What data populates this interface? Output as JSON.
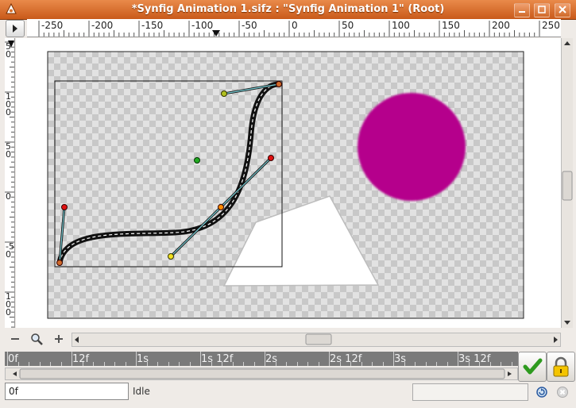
{
  "window": {
    "title": "*Synfig Animation 1.sifz : \"Synfig Animation 1\" (Root)"
  },
  "ruler_h": {
    "labels": [
      "-250",
      "-200",
      "-150",
      "-100",
      "-50",
      "0",
      "50",
      "100",
      "150",
      "200",
      "250"
    ]
  },
  "ruler_v": {
    "labels": [
      "5\n0",
      "1\n0\n0",
      "5\n0",
      "0",
      "-5\n0",
      "1\n0\n0"
    ]
  },
  "timebar": {
    "labels": [
      "0f",
      "12f",
      "1s",
      "1s 12f",
      "2s",
      "2s 12f",
      "3s",
      "3s 12f"
    ]
  },
  "time_field": {
    "value": "0f"
  },
  "status": {
    "text": "Idle"
  },
  "icons": {
    "app": "synfig-app-icon",
    "minimize": "minimize-icon",
    "maximize": "maximize-icon",
    "close": "close-icon",
    "zoom_out": "zoom-out-icon",
    "zoom_fit": "magnifier-icon",
    "zoom_in": "zoom-in-icon",
    "apply": "checkmark-icon",
    "lock": "lock-icon",
    "refresh": "refresh-icon",
    "stop": "stop-icon"
  },
  "colors": {
    "title_orange": "#d8722f",
    "circle_magenta": "#b5008c",
    "duck_red": "#e01010",
    "duck_green": "#22aa22",
    "duck_yellow": "#f0e020",
    "duck_orange": "#ff8c00"
  }
}
